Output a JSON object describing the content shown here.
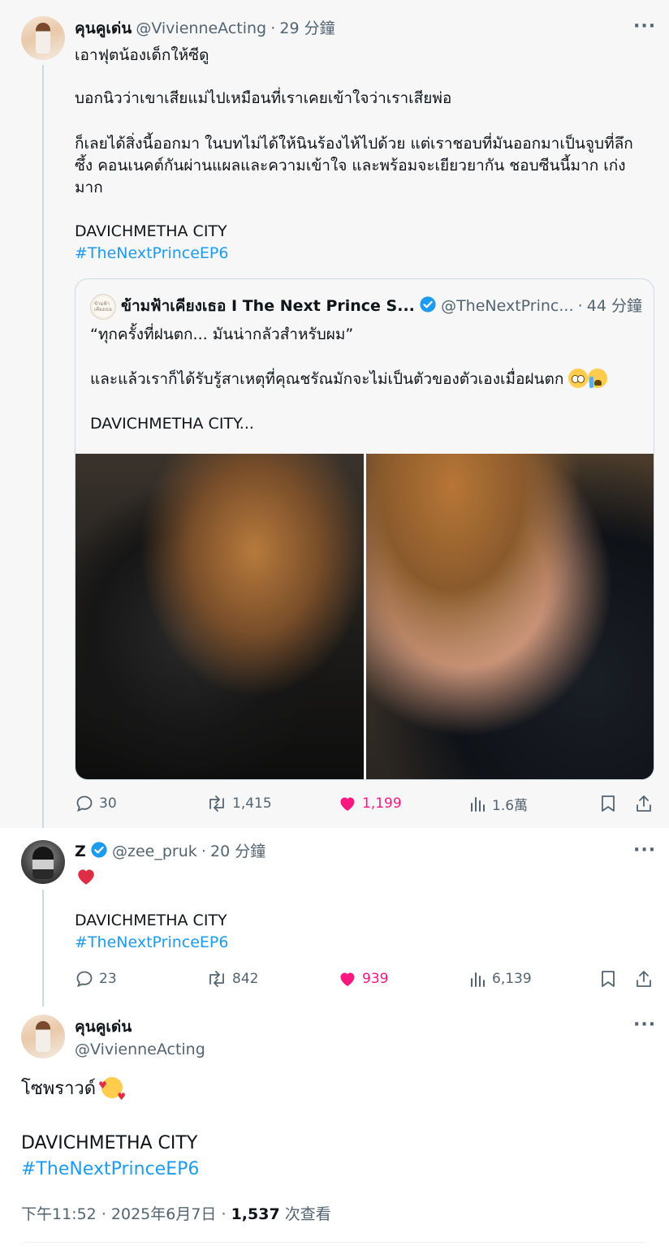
{
  "tweet1": {
    "name": "คุนคูเด่น",
    "handle": "@VivienneActing",
    "sep": "·",
    "time": "29 分鐘",
    "text1": "เอาฟุตน้องเด็กให้ซีดู",
    "text2": "บอกนิวว่าเขาเสียแม่ไปเหมือนที่เราเคยเข้าใจว่าเราเสียพ่อ",
    "text3a": "ก็เลยได้สิ่งนี้ออกมา ในบทไม่ได้ให้นินร้องไห้ไปด้วย แต่เราชอบที่มันออกมาเป็นจูบที่ลึก",
    "text3b": "ซึ้ง คอนเนคต์กันผ่านแผลและความเข้าใจ และพร้อมจะเยียวยากัน ชอบซีนนี้มาก เก่ง",
    "text3c": "มาก",
    "city": "DAVICHMETHA CITY",
    "hashtag": "#TheNextPrinceEP6",
    "quote": {
      "avatar_text": "ข้ามฟ้าเคียงเธอ",
      "name": "ข้ามฟ้าเคียงเธอ I The Next Prince S...",
      "handle": "@TheNextPrinc...",
      "sep": "·",
      "time": "44 分鐘",
      "line1": "“ทุกครั้งที่ฝนตก... มันน่ากลัวสำหรับผม”",
      "line2": "และแล้วเราก็ได้รับรู้สาเหตุที่คุณชรัณมักจะไม่เป็นตัวของตัวเองเมื่อฝนตก",
      "line3": "DAVICHMETHA CITY..."
    },
    "stats": {
      "replies": "30",
      "retweets": "1,415",
      "likes": "1,199",
      "views": "1.6萬"
    }
  },
  "tweet2": {
    "name": "Z",
    "handle": "@zee_pruk",
    "sep": "·",
    "time": "20 分鐘",
    "city": "DAVICHMETHA CITY",
    "hashtag": "#TheNextPrinceEP6",
    "stats": {
      "replies": "23",
      "retweets": "842",
      "likes": "939",
      "views": "6,139"
    }
  },
  "tweet3": {
    "name": "คุนคูเด่น",
    "handle": "@VivienneActing",
    "text": "โซพราวด์",
    "city": "DAVICHMETHA CITY",
    "hashtag": "#TheNextPrinceEP6",
    "time": "下午11:52",
    "sep": "·",
    "date": "2025年6月7日",
    "views_count": "1,537",
    "views_label": "次查看"
  },
  "colors": {
    "accent": "#1d9bf0",
    "like": "#f91880",
    "verified": "#1d9bf0",
    "secondary": "#536471"
  }
}
